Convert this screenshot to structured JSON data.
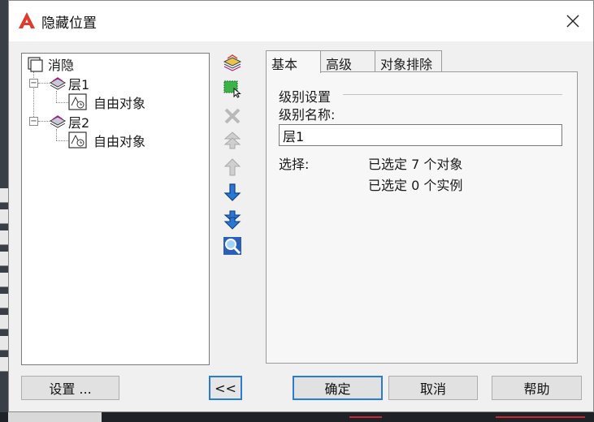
{
  "window": {
    "title": "隐藏位置",
    "close_label": "✕"
  },
  "tree": {
    "root": {
      "label": "消隐",
      "icon": "hide-group-icon"
    },
    "layers": [
      {
        "label": "层1",
        "expander": "−",
        "icon": "layer-icon",
        "child": {
          "label": "自由对象",
          "icon": "free-object-icon"
        }
      },
      {
        "label": "层2",
        "expander": "−",
        "icon": "layer-icon",
        "child": {
          "label": "自由对象",
          "icon": "free-object-icon"
        }
      }
    ]
  },
  "toolbar": [
    {
      "icon": "new-layer-icon",
      "enabled": true
    },
    {
      "icon": "select-objects-icon",
      "enabled": true
    },
    {
      "icon": "delete-icon",
      "enabled": false
    },
    {
      "icon": "move-to-top-icon",
      "enabled": false
    },
    {
      "icon": "move-up-icon",
      "enabled": false
    },
    {
      "icon": "move-down-icon",
      "enabled": true
    },
    {
      "icon": "move-to-bottom-icon",
      "enabled": true
    },
    {
      "icon": "zoom-to-object-icon",
      "enabled": true
    }
  ],
  "tabs": [
    {
      "label": "基本",
      "active": true
    },
    {
      "label": "高级",
      "active": false
    },
    {
      "label": "对象排除",
      "active": false
    }
  ],
  "basic": {
    "group_title": "级别设置",
    "name_label": "级别名称:",
    "name_value": "层1",
    "selection_label": "选择:",
    "selected_objects": "已选定 7 个对象",
    "selected_instances": "已选定 0 个实例"
  },
  "buttons": {
    "settings": "设置 ...",
    "collapse": "<<",
    "ok": "确定",
    "cancel": "取消",
    "help": "帮助"
  },
  "colors": {
    "accent": "#2a7bd6",
    "app_icon_red": "#e03a2f"
  }
}
